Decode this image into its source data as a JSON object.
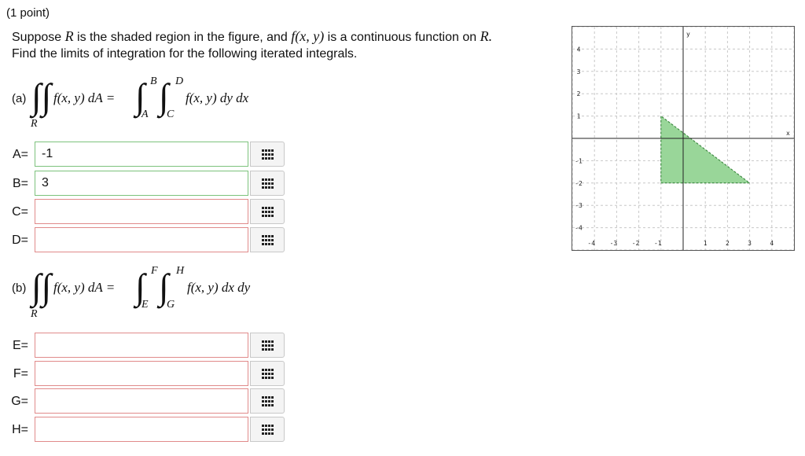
{
  "header": {
    "points": "(1 point)",
    "line1_a": "Suppose ",
    "line1_R": "R",
    "line1_b": " is the shaded region in the figure, and ",
    "line1_f": "f(x, y)",
    "line1_c": " is a continuous function on ",
    "line1_R2": "R.",
    "line2": "Find the limits of integration for the following iterated integrals."
  },
  "part_a": {
    "label": "(a)",
    "lhs": "f(x, y) dA =",
    "region": "R",
    "upper_outer": "B",
    "lower_outer": "A",
    "upper_inner": "D",
    "lower_inner": "C",
    "rhs": "f(x, y) dy dx",
    "fields": [
      {
        "label": "A=",
        "value": "-1",
        "status": "correct"
      },
      {
        "label": "B=",
        "value": "3",
        "status": "correct"
      },
      {
        "label": "C=",
        "value": "",
        "status": "incorrect"
      },
      {
        "label": "D=",
        "value": "",
        "status": "incorrect"
      }
    ]
  },
  "part_b": {
    "label": "(b)",
    "lhs": "f(x, y) dA =",
    "region": "R",
    "upper_outer": "F",
    "lower_outer": "E",
    "upper_inner": "H",
    "lower_inner": "G",
    "rhs": "f(x, y) dx dy",
    "fields": [
      {
        "label": "E=",
        "value": "",
        "status": "incorrect"
      },
      {
        "label": "F=",
        "value": "",
        "status": "incorrect"
      },
      {
        "label": "G=",
        "value": "",
        "status": "incorrect"
      },
      {
        "label": "H=",
        "value": "",
        "status": "incorrect"
      }
    ]
  },
  "figure": {
    "x_axis_label": "x",
    "y_axis_label": "y",
    "x_ticks": [
      "-4",
      "-3",
      "-2",
      "-1",
      "1",
      "2",
      "3",
      "4"
    ],
    "y_ticks": [
      "4",
      "3",
      "2",
      "1",
      "-1",
      "-2",
      "-3",
      "-4"
    ],
    "x_range": [
      -5,
      5
    ],
    "y_range": [
      -5,
      5
    ],
    "region_vertices": [
      [
        -1,
        1
      ],
      [
        -1,
        -2
      ],
      [
        3,
        -2
      ]
    ],
    "region_color": "#99d699",
    "region_stroke": "#2e7d32",
    "grid": true
  },
  "icons": {
    "palette": "grid-icon"
  }
}
